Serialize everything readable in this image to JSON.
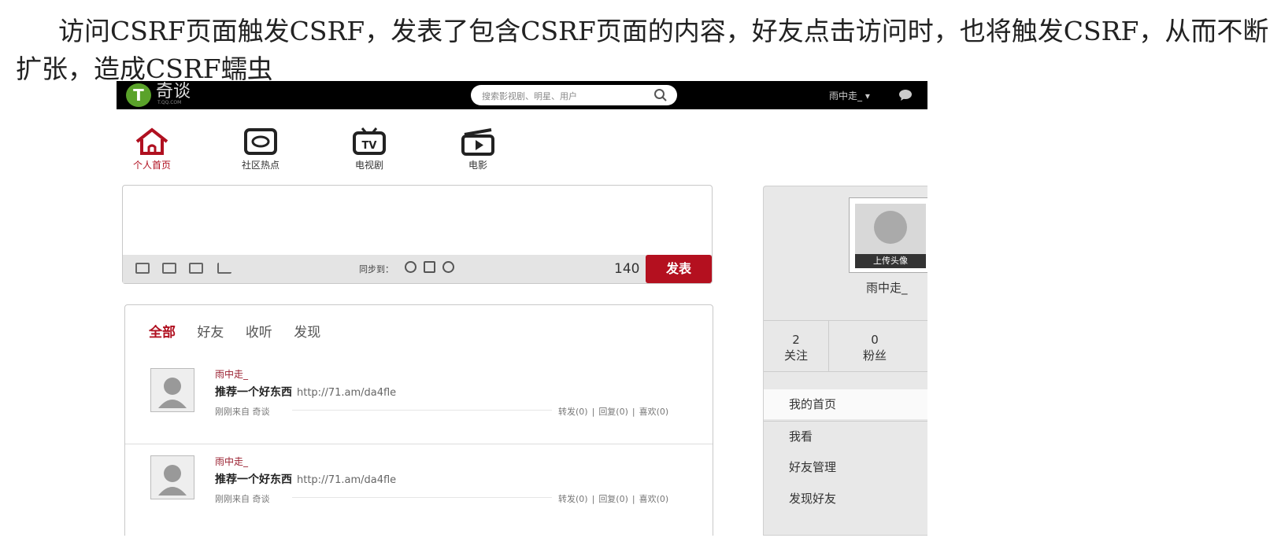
{
  "caption": "访问CSRF页面触发CSRF，发表了包含CSRF页面的内容，好友点击访问时，也将触发CSRF，从而不断扩张，造成CSRF蠕虫",
  "topbar": {
    "logo_letter": "T",
    "logo_text": "奇谈",
    "logo_sub": "T.QQ.COM",
    "search_placeholder": "搜索影视剧、明星、用户",
    "user_menu": "雨中走_ ▾"
  },
  "nav": [
    {
      "label": "个人首页",
      "icon": "home-icon",
      "active": true
    },
    {
      "label": "社区热点",
      "icon": "community-icon",
      "active": false
    },
    {
      "label": "电视剧",
      "icon": "tv-icon",
      "active": false
    },
    {
      "label": "电影",
      "icon": "film-icon",
      "active": false
    }
  ],
  "composer": {
    "sync_label": "同步到：",
    "char_count": "140",
    "publish_label": "发表"
  },
  "feed": {
    "tabs": [
      "全部",
      "好友",
      "收听",
      "发现"
    ],
    "items": [
      {
        "author": "雨中走_",
        "text": "推荐一个好东西",
        "link": "http://71.am/da4fle",
        "meta": "刚刚来自 奇谈",
        "forward": "转发(0)",
        "reply": "回复(0)",
        "like": "喜欢(0)"
      },
      {
        "author": "雨中走_",
        "text": "推荐一个好东西",
        "link": "http://71.am/da4fle",
        "meta": "刚刚来自 奇谈",
        "forward": "转发(0)",
        "reply": "回复(0)",
        "like": "喜欢(0)"
      }
    ]
  },
  "sidebar": {
    "upload_label": "上传头像",
    "username": "雨中走_",
    "following_count": "2",
    "following_label": "关注",
    "followers_count": "0",
    "followers_label": "粉丝",
    "menu": [
      "我的首页",
      "我看",
      "好友管理",
      "发现好友"
    ]
  },
  "colors": {
    "accent": "#b4101f",
    "topbar": "#000000",
    "logo": "#5aa22a"
  }
}
